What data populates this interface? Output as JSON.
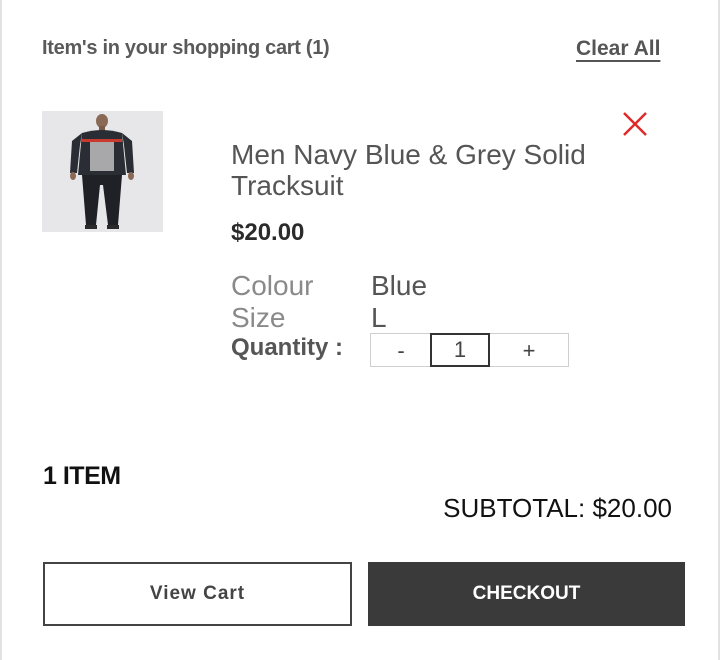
{
  "cart": {
    "title": "Item's in your shopping cart (1)",
    "clear_all_label": "Clear All"
  },
  "item": {
    "image_icon": "tracksuit-product-image",
    "name": "Men Navy Blue & Grey Solid Tracksuit",
    "price": "$20.00",
    "colour_label": "Colour",
    "colour_value": "Blue",
    "size_label": "Size",
    "size_value": "L",
    "quantity_label": "Quantity :",
    "quantity_minus": "-",
    "quantity_value": "1",
    "quantity_plus": "+",
    "remove_icon": "close-icon"
  },
  "summary": {
    "item_count": "1 ITEM",
    "subtotal": "SUBTOTAL: $20.00"
  },
  "buttons": {
    "view_cart": "View Cart",
    "checkout": "CHECKOUT"
  },
  "colors": {
    "remove_icon": "#e02a2a",
    "checkout_bg": "#3a3a3a"
  }
}
